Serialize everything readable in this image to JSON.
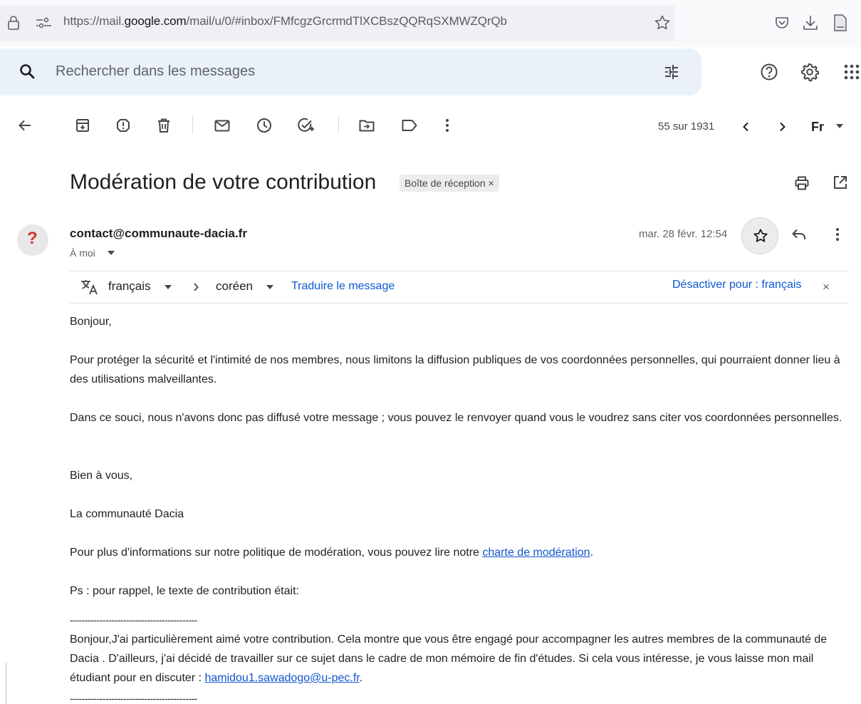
{
  "browser": {
    "url_prefix": "https://mail.",
    "url_domain": "google.com",
    "url_suffix": "/mail/u/0/#inbox/FMfcgzGrcrmdTlXCBszQQRqSXMWZQrQb",
    "icons": [
      "lock-icon",
      "permissions-icon",
      "bookmark-star-icon",
      "pocket-icon",
      "download-icon",
      "pdf-icon"
    ]
  },
  "search": {
    "placeholder": "Rechercher dans les messages",
    "icons": [
      "search-icon",
      "filter-options-icon",
      "help-icon",
      "settings-icon",
      "apps-grid-icon"
    ]
  },
  "toolbar": {
    "count": "55 sur 1931",
    "language_menu": "Fr"
  },
  "message": {
    "subject": "Modération de votre contribution",
    "label": "Boîte de réception",
    "label_remove": "×",
    "sender": "contact@communaute-dacia.fr",
    "recipient": "À moi",
    "date": "mar. 28 févr. 12:54",
    "avatar_glyph": "?",
    "avatar_color": "#d93025"
  },
  "translate": {
    "from_lang": "français",
    "to_lang": "coréen",
    "translate_link": "Traduire le message",
    "disable_link": "Désactiver pour : français",
    "close": "×",
    "arrow": "›"
  },
  "body": {
    "greeting": "Bonjour,",
    "para1": "Pour protéger la sécurité et l'intimité de nos membres, nous limitons la diffusion publiques de vos coordonnées personnelles, qui pourraient donner lieu à des utilisations malveillantes.",
    "para2": "Dans ce souci, nous n'avons donc pas diffusé votre message ; vous pouvez le renvoyer quand vous le voudrez sans citer vos coordonnées personnelles.",
    "closing": "Bien à vous,",
    "signature": "La communauté Dacia",
    "policy_text": "Pour plus d'informations sur notre politique de modération, vous pouvez lire notre ",
    "policy_link": "charte de modération",
    "policy_end": ".",
    "ps": "Ps : pour rappel, le texte de contribution était:",
    "separator": "-------------------------------------------",
    "quoted_text": "Bonjour,J'ai particulièrement aimé votre contribution. Cela montre que vous être engagé pour accompagner les autres membres de la communauté de Dacia . D'ailleurs, j'ai décidé de travailler sur ce sujet dans le cadre de mon mémoire de fin d'études. Si cela vous intéresse, je vous laisse mon mail étudiant pour en discuter : ",
    "quoted_email": "hamidou1.sawadogo@u-pec.fr",
    "quoted_end": "."
  },
  "colors": {
    "search_bg": "#eaf1fb",
    "link": "#1155cc",
    "translate_link": "#0b57d0"
  }
}
